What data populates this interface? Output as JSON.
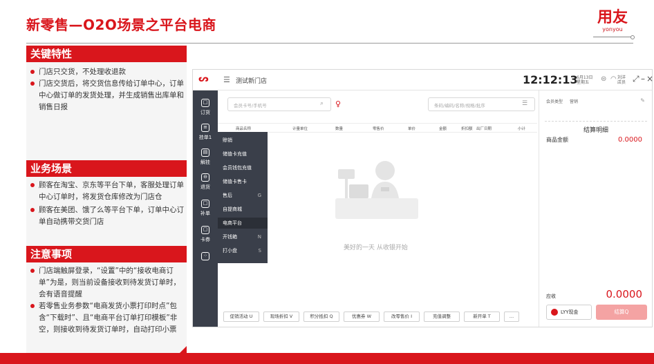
{
  "slide": {
    "title": "新零售—O2O场景之平台电商",
    "brand_cn": "用友",
    "brand_en": "yonyou"
  },
  "sections": {
    "features": {
      "title": "关键特性",
      "items": [
        "门店只交货，不处理收退款",
        "门店交货后，将交货信息传给订单中心，订单中心做订单的发货处理，并生成销售出库单和销售日报"
      ]
    },
    "scenarios": {
      "title": "业务场景",
      "items": [
        "顾客在淘宝、京东等平台下单，客服处理订单中心订单时，将发货仓库修改为门店仓",
        "顾客在美团、饿了么等平台下单，订单中心订单自动携带交货门店"
      ]
    },
    "notes": {
      "title": "注意事项",
      "items": [
        "门店端触屏登录，“设置”中的“接收电商订单”为是，则当前设备接收到待发货订单时，会有语音提醒",
        "若零售业务参数“电商发货小票打印时点”包含“下载时”、且“电商平台订单打印模板”非空，则接收到待发货订单时，自动打印小票"
      ]
    }
  },
  "pos": {
    "store": "测试新门店",
    "clock": "12:12:13",
    "date_line1": "6月13日",
    "date_line2": "星期五",
    "user_line1": "刘洋",
    "user_line2": "店员",
    "sidebar": [
      {
        "icon": "□",
        "label": "订货"
      },
      {
        "icon": "≡",
        "label": "挂单1"
      },
      {
        "icon": "▤",
        "label": "解挂"
      },
      {
        "icon": "⊖",
        "label": "退货"
      },
      {
        "icon": "□",
        "label": "补单"
      },
      {
        "icon": "▢",
        "label": "卡券"
      },
      {
        "icon": "⁘",
        "label": ""
      }
    ],
    "search_placeholder": "会员卡号/手机号",
    "search2_placeholder": "条码/编码/名称/规格/批序",
    "columns": [
      "商品名称",
      "计量单位",
      "数量",
      "零售价",
      "单价",
      "金额",
      "折扣额",
      "出厂日期",
      "小计"
    ],
    "dropdown": [
      {
        "label": "赊销",
        "key": ""
      },
      {
        "label": "储值卡充值",
        "key": ""
      },
      {
        "label": "会员钱包充值",
        "key": ""
      },
      {
        "label": "储值卡售卡",
        "key": ""
      },
      {
        "label": "售后",
        "key": "G"
      },
      {
        "label": "自提商城",
        "key": ""
      },
      {
        "label": "电商平台",
        "key": ""
      },
      {
        "label": "开钱箱",
        "key": "N"
      },
      {
        "label": "打小盘",
        "key": "S"
      }
    ],
    "empty_text": "美好的一天 从收银开始",
    "bottom_buttons": [
      "促销活动 U",
      "现场折扣 V",
      "积分抵扣 Q",
      "优惠券 W",
      "改零售价 I",
      "充值调整",
      "新开单 T",
      "…"
    ],
    "right": {
      "tab1": "会员类型",
      "tab2": "营销",
      "title": "结算明细",
      "amount_label": "商品金额",
      "amount_value": "0.0000",
      "due_label": "应收",
      "due_value": "0.0000",
      "cash_button": "LYY现金",
      "checkout_button": "结算Q"
    }
  },
  "colors": {
    "accent": "#d9161c",
    "sidebar": "#3a3f4a"
  }
}
